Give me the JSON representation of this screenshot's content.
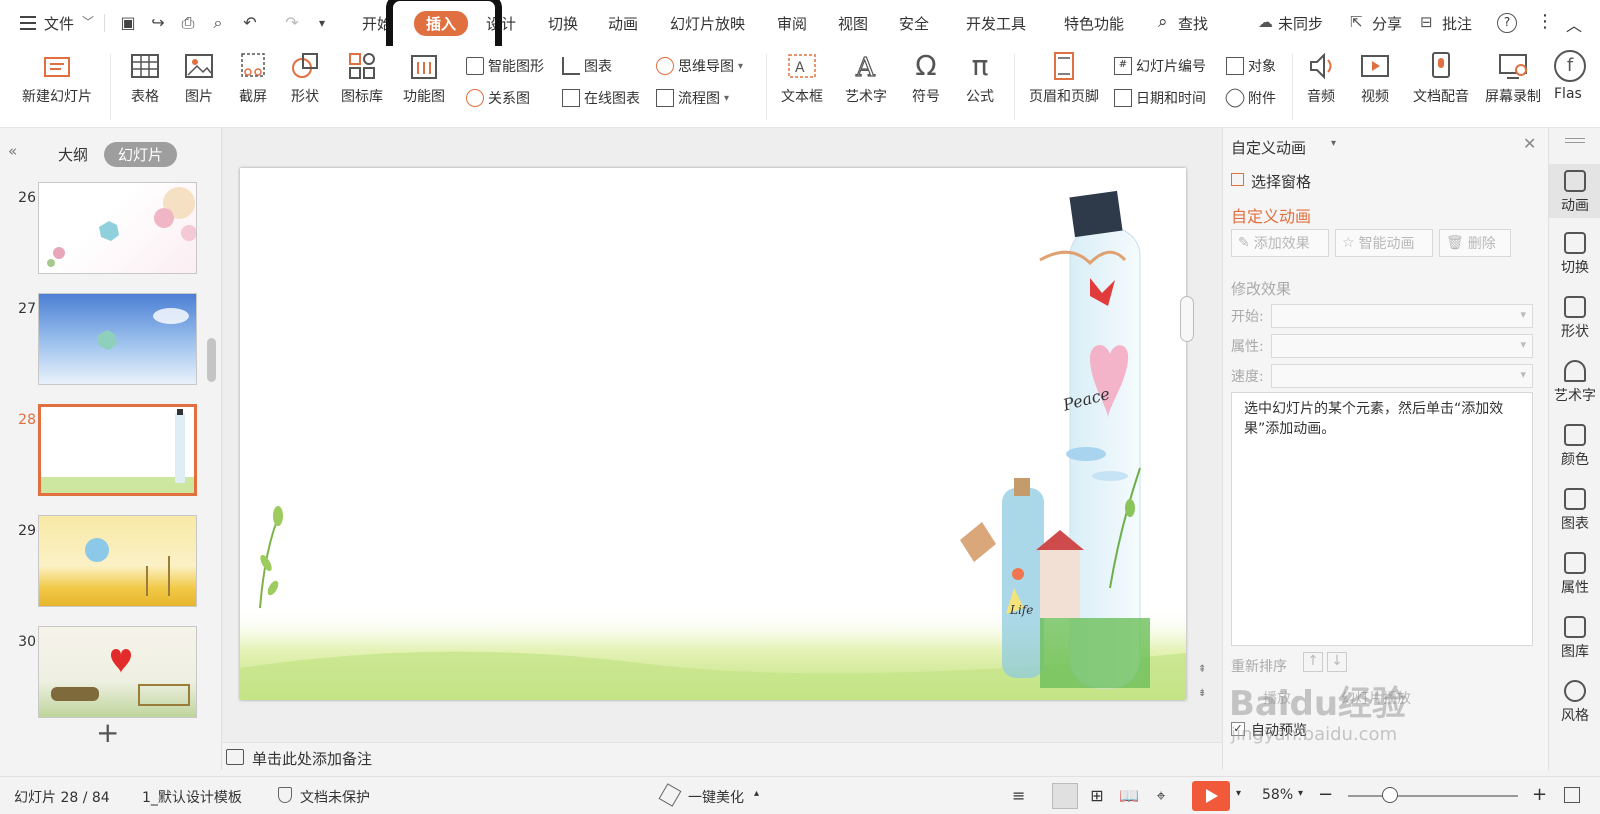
{
  "menubar": {
    "file_label": "文件",
    "tabs": [
      "开始",
      "插入",
      "设计",
      "切换",
      "动画",
      "幻灯片放映",
      "审阅",
      "视图",
      "安全",
      "开发工具",
      "特色功能"
    ],
    "search_label": "查找",
    "sync_label": "未同步",
    "share_label": "分享",
    "comment_label": "批注"
  },
  "ribbon": {
    "new_slide": "新建幻灯片",
    "table": "表格",
    "picture": "图片",
    "screenshot": "截屏",
    "shape": "形状",
    "icon_lib": "图标库",
    "function_chart": "功能图",
    "smart_graphic": "智能图形",
    "chart": "图表",
    "relation_chart": "关系图",
    "online_chart": "在线图表",
    "mind_map": "思维导图",
    "flowchart": "流程图",
    "textbox": "文本框",
    "wordart": "艺术字",
    "symbol": "符号",
    "formula": "公式",
    "header_footer": "页眉和页脚",
    "slide_number": "幻灯片编号",
    "object": "对象",
    "date_time": "日期和时间",
    "attachment": "附件",
    "audio": "音频",
    "video": "视频",
    "doc_dub": "文档配音",
    "screen_record": "屏幕录制",
    "flash": "Flas"
  },
  "leftpanel": {
    "tab_outline": "大纲",
    "tab_slides": "幻灯片",
    "thumbs": [
      {
        "num": "26"
      },
      {
        "num": "27"
      },
      {
        "num": "28"
      },
      {
        "num": "29"
      },
      {
        "num": "30"
      }
    ],
    "add_symbol": "+"
  },
  "notes": {
    "placeholder": "单击此处添加备注"
  },
  "rightpane": {
    "title": "自定义动画",
    "select_pane": "选择窗格",
    "section_title": "自定义动画",
    "add_effect": "添加效果",
    "smart_anim": "智能动画",
    "delete": "删除",
    "modify_title": "修改效果",
    "start_label": "开始:",
    "property_label": "属性:",
    "speed_label": "速度:",
    "hint": "选中幻灯片的某个元素，然后单击“添加效果”添加动画。",
    "reorder_label": "重新排序",
    "play_label": "播放",
    "preview_label": "幻灯片播放",
    "auto_preview": "自动预览"
  },
  "sidestrip": [
    "动画",
    "切换",
    "形状",
    "艺术字",
    "颜色",
    "图表",
    "属性",
    "图库",
    "风格"
  ],
  "statusbar": {
    "slide_info": "幻灯片 28 / 84",
    "template": "1_默认设计模板",
    "protect": "文档未保护",
    "beautify": "一键美化",
    "zoom": "58%"
  },
  "watermark": {
    "brand": "Baidu经验",
    "url": "jingyan.baidu.com"
  },
  "slide_text": {
    "peace": "Peace",
    "life": "Life"
  },
  "colors": {
    "accent": "#e0703f",
    "play": "#f05a3a"
  }
}
